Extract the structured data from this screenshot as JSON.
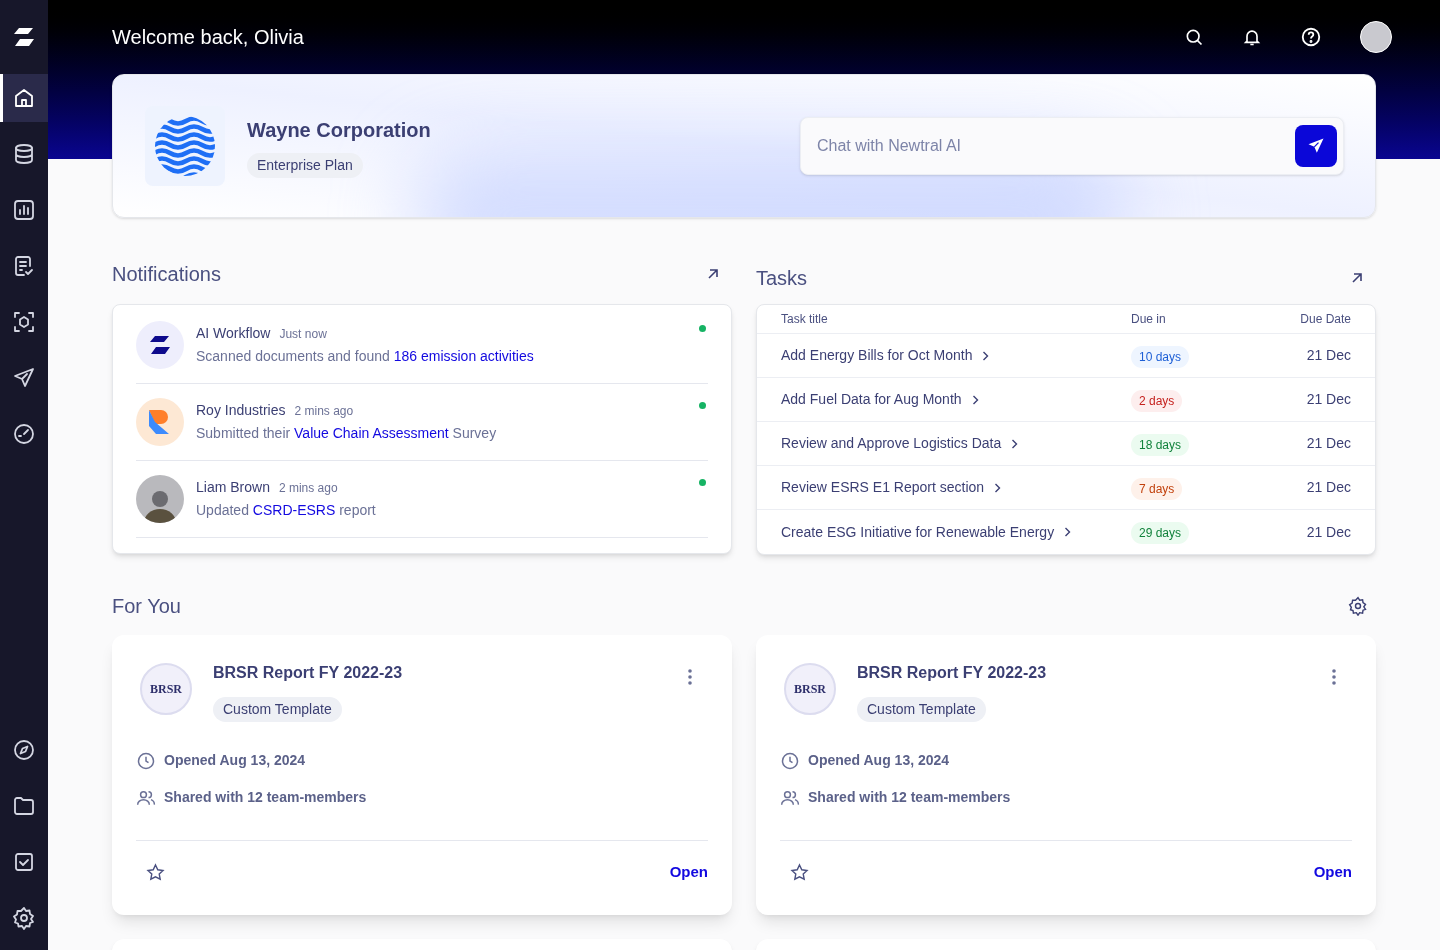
{
  "sidebar": {
    "items": [
      {
        "kind": "home",
        "selected": true
      },
      {
        "kind": "database",
        "selected": false
      },
      {
        "kind": "chart",
        "selected": false
      },
      {
        "kind": "checklist",
        "selected": false
      },
      {
        "kind": "scan",
        "selected": false
      },
      {
        "kind": "send",
        "selected": false
      },
      {
        "kind": "gauge",
        "selected": false
      }
    ],
    "bottom_items": [
      {
        "kind": "compass",
        "selected": false
      },
      {
        "kind": "folder",
        "selected": false
      },
      {
        "kind": "checkbox",
        "selected": false
      },
      {
        "kind": "settings",
        "selected": false
      }
    ]
  },
  "header": {
    "greeting": "Welcome back, Olivia"
  },
  "organization": {
    "name": "Wayne Corporation",
    "plan": "Enterprise Plan"
  },
  "chat": {
    "placeholder": "Chat with Newtral AI"
  },
  "notifications": {
    "title": "Notifications",
    "items": [
      {
        "kind": "workflow",
        "name": "AI Workflow",
        "time": "Just now",
        "message": [
          {
            "text": "Scanned documents and found ",
            "link": false
          },
          {
            "text": "186 emission activities",
            "link": true
          }
        ],
        "unread": true
      },
      {
        "kind": "company",
        "name": "Roy Industries",
        "time": "2 mins ago",
        "message": [
          {
            "text": "Submitted their ",
            "link": false
          },
          {
            "text": "Value Chain Assessment",
            "link": true
          },
          {
            "text": " Survey",
            "link": false
          }
        ],
        "unread": true
      },
      {
        "kind": "person",
        "name": "Liam Brown",
        "time": "2 mins ago",
        "message": [
          {
            "text": "Updated ",
            "link": false
          },
          {
            "text": "CSRD-ESRS",
            "link": true
          },
          {
            "text": " report",
            "link": false
          }
        ],
        "unread": true
      }
    ]
  },
  "tasks": {
    "title": "Tasks",
    "columns": [
      "Task title",
      "Due in",
      "Due Date"
    ],
    "rows": [
      {
        "title": "Add Energy Bills for Oct Month",
        "due_in": "10 days",
        "kind": "info",
        "due_date": "21 Dec"
      },
      {
        "title": "Add Fuel Data for Aug Month",
        "due_in": "2 days",
        "kind": "danger",
        "due_date": "21 Dec"
      },
      {
        "title": "Review and Approve Logistics Data",
        "due_in": "18 days",
        "kind": "success",
        "due_date": "21 Dec"
      },
      {
        "title": "Review ESRS E1 Report section",
        "due_in": "7 days",
        "kind": "warning",
        "due_date": "21 Dec"
      },
      {
        "title": "Create ESG Initiative for Renewable Energy",
        "due_in": "29 days",
        "kind": "success",
        "due_date": "21 Dec"
      }
    ]
  },
  "for_you": {
    "title": "For You",
    "cards": [
      {
        "logo": "BRSR",
        "title": "BRSR Report FY 2022-23",
        "tag": "Custom Template",
        "opened": "Opened Aug 13, 2024",
        "shared": "Shared with 12 team-members",
        "starred": false,
        "action": "Open"
      },
      {
        "logo": "BRSR",
        "title": "BRSR Report FY 2022-23",
        "tag": "Custom Template",
        "opened": "Opened Aug 13, 2024",
        "shared": "Shared with 12 team-members",
        "starred": false,
        "action": "Open"
      }
    ]
  }
}
